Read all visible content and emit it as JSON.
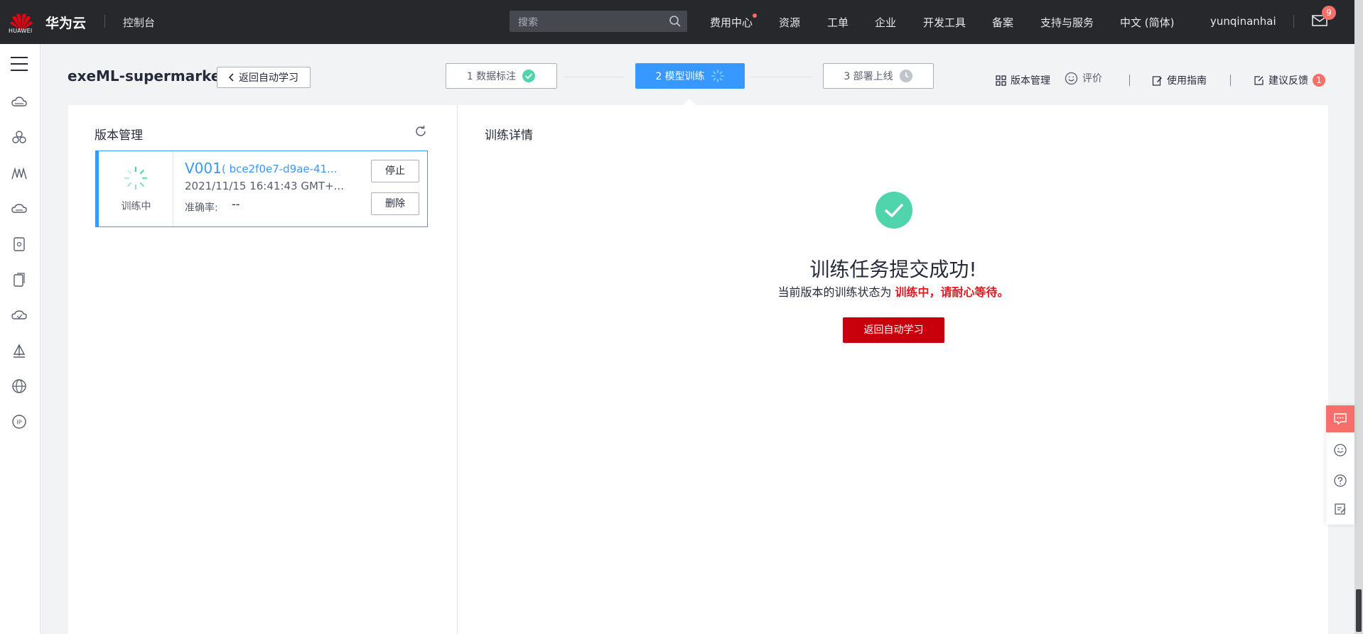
{
  "topbar": {
    "logo_text": "HUAWEI",
    "brand": "华为云",
    "console": "控制台",
    "search_placeholder": "搜索",
    "nav": [
      "费用中心",
      "资源",
      "工单",
      "企业",
      "开发工具",
      "备案",
      "支持与服务",
      "中文 (简体)",
      "yunqinanhai"
    ],
    "mail_count": "9"
  },
  "header": {
    "title": "exeML-supermarket",
    "back_label": "返回自动学习",
    "steps": [
      "1 数据标注",
      "2 模型训练",
      "3 部署上线"
    ],
    "links": {
      "version": "版本管理",
      "rate": "评价",
      "guide": "使用指南",
      "feedback": "建议反馈",
      "feedback_count": "1"
    }
  },
  "left_panel": {
    "title": "版本管理",
    "card": {
      "status": "训练中",
      "name": "V001",
      "id": "( bce2f0e7-d9ae-41...",
      "date": "2021/11/15 16:41:43 GMT+...",
      "accuracy_label": "准确率:",
      "accuracy_value": "--",
      "stop": "停止",
      "delete": "删除"
    }
  },
  "right_panel": {
    "title": "训练详情",
    "success_title": "训练任务提交成功!",
    "status_prefix": "当前版本的训练状态为",
    "status_highlight": "训练中，请耐心等待。",
    "back_button": "返回自动学习"
  },
  "colors": {
    "accent_blue": "#3799ff",
    "success_green": "#50d4ab",
    "brand_red": "#c7000b",
    "highlight_red": "#e3171e",
    "badge_red": "#f66f6a"
  }
}
